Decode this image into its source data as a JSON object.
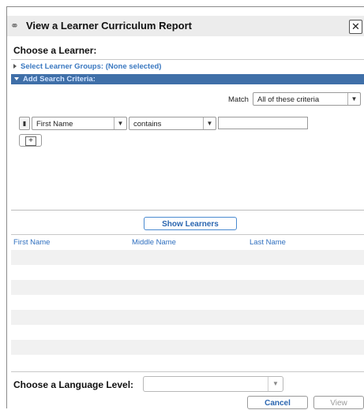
{
  "dialog": {
    "title": "View a Learner Curriculum Report",
    "close_glyph": "✕",
    "title_icon": "person-icon"
  },
  "learner": {
    "heading": "Choose a Learner:",
    "groups_label": "Select Learner Groups: (None selected)",
    "search_label": "Add Search Criteria:"
  },
  "criteria": {
    "match_label": "Match",
    "match_value": "All of these criteria",
    "field_value": "First Name",
    "operator_value": "contains",
    "text_value": "",
    "add_glyph": "+"
  },
  "show_learners_label": "Show Learners",
  "grid": {
    "columns": [
      "First Name",
      "Middle Name",
      "Last Name"
    ],
    "rows": []
  },
  "language": {
    "label": "Choose a Language Level:",
    "value": ""
  },
  "buttons": {
    "cancel": "Cancel",
    "view": "View"
  },
  "colors": {
    "accent": "#2f6fbf",
    "search_bar": "#3f6fa8"
  }
}
